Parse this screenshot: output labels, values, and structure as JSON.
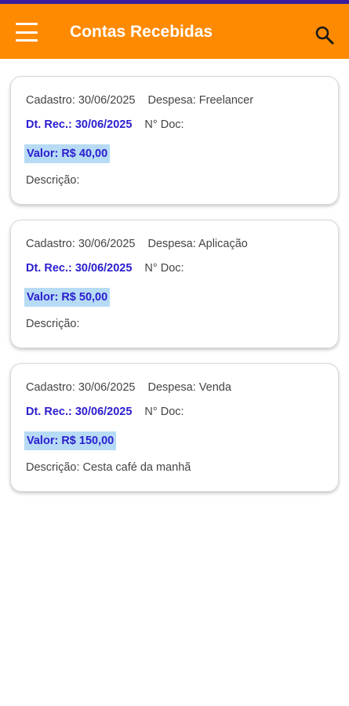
{
  "app_bar": {
    "title": "Contas Recebidas",
    "background": "#fe8a01",
    "status_strip_color": "#3a1c9c",
    "menu_icon": "hamburger-menu-icon",
    "search_icon": "search-icon"
  },
  "cards": [
    {
      "cadastro": "Cadastro: 30/06/2025",
      "despesa": "Despesa: Freelancer",
      "dt_rec": "Dt. Rec.: 30/06/2025",
      "n_doc": "N° Doc:",
      "valor": "Valor: R$ 40,00",
      "descricao": "Descrição:"
    },
    {
      "cadastro": "Cadastro: 30/06/2025",
      "despesa": "Despesa: Aplicação",
      "dt_rec": "Dt. Rec.: 30/06/2025",
      "n_doc": "N° Doc:",
      "valor": "Valor: R$ 50,00",
      "descricao": "Descrição:"
    },
    {
      "cadastro": "Cadastro: 30/06/2025",
      "despesa": "Despesa: Venda",
      "dt_rec": "Dt. Rec.: 30/06/2025",
      "n_doc": "N° Doc:",
      "valor": "Valor: R$ 150,00",
      "descricao": "Descrição: Cesta café da manhã"
    }
  ],
  "colors": {
    "accent_blue": "#2a1dcf",
    "valor_highlight": "#b7dbf5"
  }
}
